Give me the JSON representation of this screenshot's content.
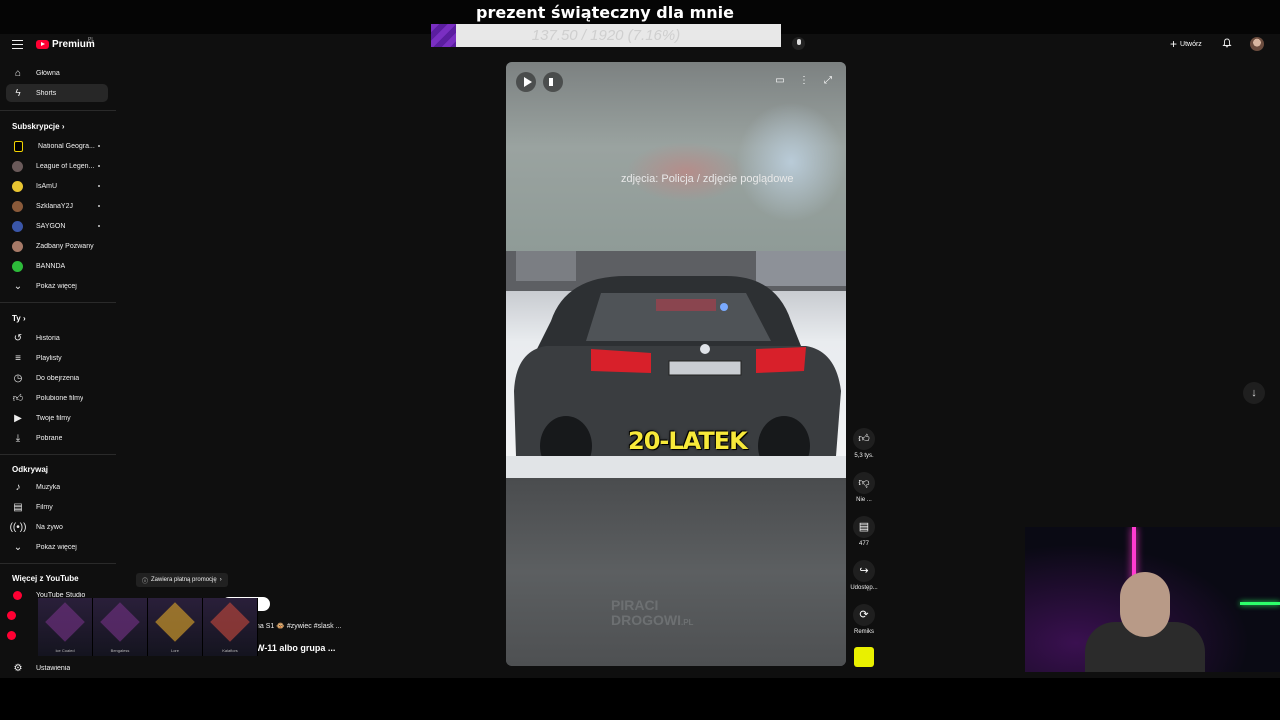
{
  "overlay": {
    "title": "prezent świąteczny dla mnie",
    "goal_text": "137.50 / 1920 (7.16%)",
    "goal_fraction": 0.0716,
    "accent_color": "#7a2fc2"
  },
  "header": {
    "brand": "Premium",
    "brand_sup": "PL",
    "create_label": "Utwórz",
    "icons": [
      "menu-icon",
      "microphone-icon",
      "bell-icon",
      "avatar"
    ]
  },
  "sidebar": {
    "main": [
      {
        "label": "Główna",
        "icon": "home-icon"
      },
      {
        "label": "Shorts",
        "icon": "shorts-icon",
        "active": true
      }
    ],
    "subscriptions_title": "Subskrypcje",
    "subscriptions": [
      {
        "label": "National Geogra...",
        "color": "#f2d400"
      },
      {
        "label": "League of Legen...",
        "color": "#6a5a5a"
      },
      {
        "label": "IsAmU",
        "color": "#e9c531"
      },
      {
        "label": "SzklanaY2J",
        "color": "#8a5a3a"
      },
      {
        "label": "SAYGON",
        "color": "#3a56a8"
      },
      {
        "label": "Zadbany Pozwany",
        "color": "#a77a68"
      },
      {
        "label": "BANNDA",
        "color": "#2dbb3a"
      }
    ],
    "show_more": "Pokaż więcej",
    "you_title": "Ty",
    "you": [
      {
        "label": "Historia",
        "icon": "history-icon"
      },
      {
        "label": "Playlisty",
        "icon": "playlist-icon"
      },
      {
        "label": "Do obejrzenia",
        "icon": "clock-icon"
      },
      {
        "label": "Polubione filmy",
        "icon": "thumbs-up-icon"
      },
      {
        "label": "Twoje filmy",
        "icon": "video-icon"
      },
      {
        "label": "Pobrane",
        "icon": "download-icon"
      }
    ],
    "explore_title": "Odkrywaj",
    "explore": [
      {
        "label": "Muzyka",
        "icon": "music-icon"
      },
      {
        "label": "Filmy",
        "icon": "film-icon"
      },
      {
        "label": "Na żywo",
        "icon": "live-icon"
      }
    ],
    "explore_more": "Pokaż więcej",
    "more_title": "Więcej z YouTube",
    "more": [
      {
        "label": "YouTube Studio"
      }
    ],
    "settings": "Ustawienia"
  },
  "video": {
    "caption": "zdjęcia: Policja / zdjęcie poglądowe",
    "overlay_text": "20-LATEK",
    "watermark_line1": "PIRACI",
    "watermark_line2": "DROGOWI",
    "watermark_suffix": ".PL",
    "promo": "Zawiera płatną promocję",
    "desc_line1": "na S1 🐵 #zywiec #slask ...",
    "desc_line2": "W-11 albo grupa ..."
  },
  "actions": {
    "like_count": "5,3 tys.",
    "dislike_label": "Nie ...",
    "comments_count": "477",
    "share_label": "Udostęp...",
    "remix_label": "Remiks"
  },
  "skins": [
    "Ice Coaled",
    "Bengaless",
    "Lore",
    "Kalafiors"
  ]
}
